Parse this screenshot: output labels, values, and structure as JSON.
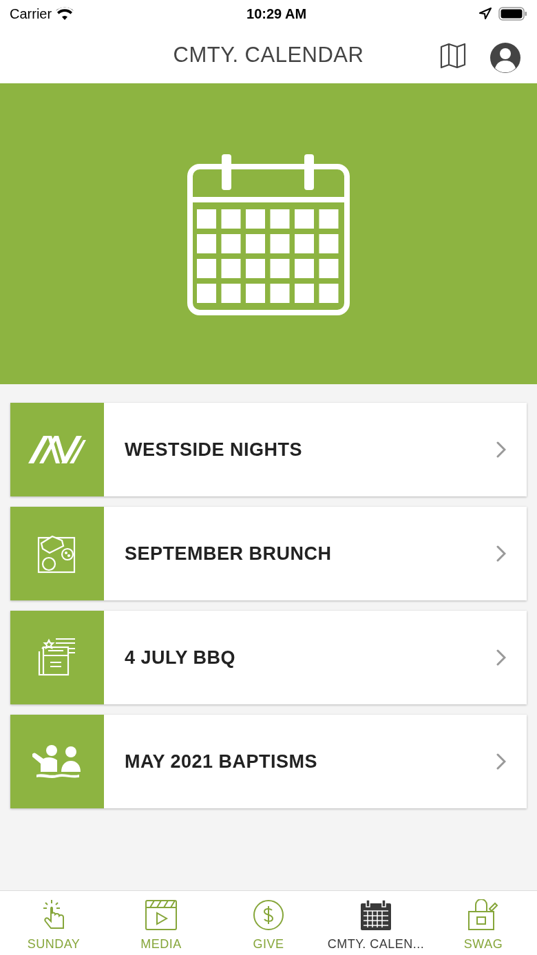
{
  "status_bar": {
    "carrier": "Carrier",
    "time": "10:29 AM"
  },
  "nav": {
    "title": "CMTY. CALENDAR"
  },
  "events": [
    {
      "title": "WESTSIDE NIGHTS",
      "kind": "logo"
    },
    {
      "title": "SEPTEMBER BRUNCH",
      "kind": "food"
    },
    {
      "title": "4 JULY BBQ",
      "kind": "july"
    },
    {
      "title": "MAY 2021 BAPTISMS",
      "kind": "people"
    }
  ],
  "tabs": [
    {
      "label": "SUNDAY",
      "kind": "tap",
      "selected": false
    },
    {
      "label": "MEDIA",
      "kind": "video",
      "selected": false
    },
    {
      "label": "GIVE",
      "kind": "dollar",
      "selected": false
    },
    {
      "label": "CMTY. CALEN...",
      "kind": "calendar",
      "selected": true
    },
    {
      "label": "SWAG",
      "kind": "bag",
      "selected": false
    }
  ]
}
